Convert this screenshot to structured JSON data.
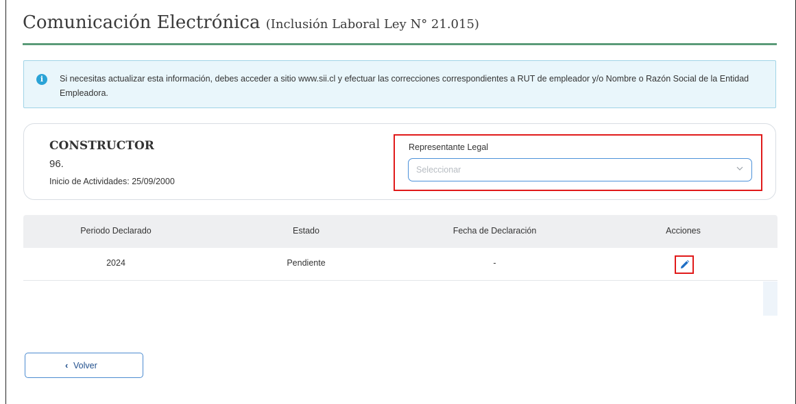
{
  "page": {
    "title": "Comunicación Electrónica",
    "subtitle": "(Inclusión Laboral Ley N° 21.015)"
  },
  "alert": {
    "icon": "info-icon",
    "text": "Si necesitas actualizar esta información, debes acceder a sitio www.sii.cl y efectuar las correcciones correspondientes a RUT de empleador y/o Nombre o Razón Social de la Entidad Empleadora."
  },
  "company": {
    "name": "CONSTRUCTOR",
    "rut": "96.",
    "start_activities": "Inicio de Actividades: 25/09/2000"
  },
  "representative": {
    "label": "Representante Legal",
    "placeholder": "Seleccionar",
    "chevron": "chevron-down-icon"
  },
  "table": {
    "headers": [
      "Periodo Declarado",
      "Estado",
      "Fecha de Declaración",
      "Acciones"
    ],
    "rows": [
      {
        "period": "2024",
        "status": "Pendiente",
        "date": "-",
        "action_icon": "pencil-icon"
      }
    ]
  },
  "footer": {
    "back_label": "Volver",
    "back_icon": "chevron-left-icon"
  },
  "colors": {
    "accent_rule": "#5a9a78",
    "alert_bg": "#e9f6fb",
    "highlight": "#e01818",
    "primary": "#1f4e8c"
  }
}
